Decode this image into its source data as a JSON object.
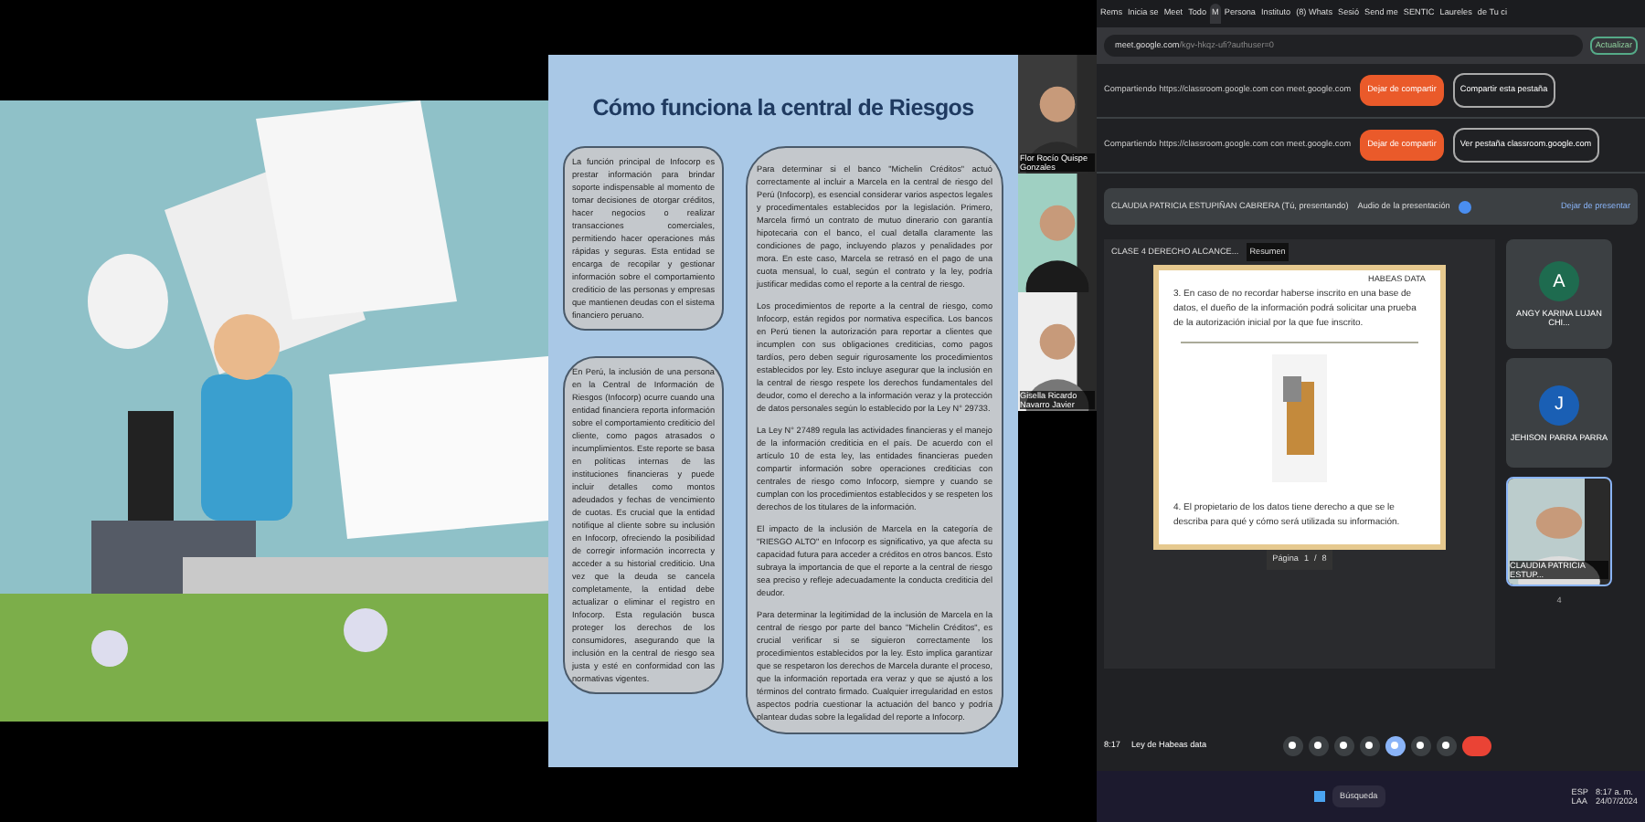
{
  "slide": {
    "title": "Cómo funciona la central de Riesgos",
    "left_boxes": [
      [
        "La función principal de Infocorp es prestar información para brindar soporte indispensable al momento de tomar decisiones de otorgar créditos, hacer negocios o realizar transacciones comerciales, permitiendo hacer operaciones más rápidas y seguras. Esta entidad se encarga de recopilar y gestionar información sobre el comportamiento crediticio de las personas y empresas que mantienen deudas con el sistema financiero peruano."
      ],
      [
        "En Perú, la inclusión de una persona en la Central de Información de Riesgos (Infocorp) ocurre cuando una entidad financiera reporta información sobre el comportamiento crediticio del cliente, como pagos atrasados o incumplimientos. Este reporte se basa en políticas internas de las instituciones financieras y puede incluir detalles como montos adeudados y fechas de vencimiento de cuotas. Es crucial que la entidad notifique al cliente sobre su inclusión en Infocorp, ofreciendo la posibilidad de corregir información incorrecta y acceder a su historial crediticio. Una vez que la deuda se cancela completamente, la entidad debe actualizar o eliminar el registro en Infocorp. Esta regulación busca proteger los derechos de los consumidores, asegurando que la inclusión en la central de riesgo sea justa y esté en conformidad con las normativas vigentes."
      ]
    ],
    "right_box": [
      "Para determinar si el banco \"Michelin Créditos\" actuó correctamente al incluir a Marcela en la central de riesgo del Perú (Infocorp), es esencial considerar varios aspectos legales y procedimentales establecidos por la legislación. Primero, Marcela firmó un contrato de mutuo dinerario con garantía hipotecaria con el banco, el cual detalla claramente las condiciones de pago, incluyendo plazos y penalidades por mora. En este caso, Marcela se retrasó en el pago de una cuota mensual, lo cual, según el contrato y la ley, podría justificar medidas como el reporte a la central de riesgo.",
      "Los procedimientos de reporte a la central de riesgo, como Infocorp, están regidos por normativa específica. Los bancos en Perú tienen la autorización para reportar a clientes que incumplen con sus obligaciones crediticias, como pagos tardíos, pero deben seguir rigurosamente los procedimientos establecidos por ley. Esto incluye asegurar que la inclusión en la central de riesgo respete los derechos fundamentales del deudor, como el derecho a la información veraz y la protección de datos personales según lo establecido por la Ley N° 29733.",
      "La Ley N° 27489 regula las actividades financieras y el manejo de la información crediticia en el país. De acuerdo con el artículo 10 de esta ley, las entidades financieras pueden compartir información sobre operaciones crediticias con centrales de riesgo como Infocorp, siempre y cuando se cumplan con los procedimientos establecidos y se respeten los derechos de los titulares de la información.",
      "El impacto de la inclusión de Marcela en la categoría de \"RIESGO ALTO\" en Infocorp es significativo, ya que afecta su capacidad futura para acceder a créditos en otros bancos. Esto subraya la importancia de que el reporte a la central de riesgo sea preciso y refleje adecuadamente la conducta crediticia del deudor.",
      "Para determinar la legitimidad de la inclusión de Marcela en la central de riesgo por parte del banco \"Michelin Créditos\", es crucial verificar si se siguieron correctamente los procedimientos establecidos por la ley. Esto implica garantizar que se respetaron los derechos de Marcela durante el proceso, que la información reportada era veraz y que se ajustó a los términos del contrato firmado. Cualquier irregularidad en estos aspectos podría cuestionar la actuación del banco y podría plantear dudas sobre la legalidad del reporte a Infocorp."
    ]
  },
  "video_tiles": [
    {
      "kind": "video",
      "name": "Flor Rocío Quispe Gonzales"
    },
    {
      "kind": "video"
    },
    {
      "kind": "video",
      "name": "Gisella Ricardo Navarro Javier"
    }
  ],
  "browser": {
    "tabs": [
      {
        "label": "Rems",
        "selected": false
      },
      {
        "label": "Inicia se",
        "selected": false
      },
      {
        "label": "Meet",
        "selected": false
      },
      {
        "label": "Todo",
        "selected": false
      },
      {
        "label": "M",
        "selected": true
      },
      {
        "label": "Persona",
        "selected": false
      },
      {
        "label": "Instituto",
        "selected": false
      },
      {
        "label": "(8) Whats",
        "selected": false
      },
      {
        "label": "Sesió",
        "selected": false
      },
      {
        "label": "Send me",
        "selected": false
      },
      {
        "label": "SENTIC",
        "selected": false
      },
      {
        "label": "Laureles",
        "selected": false
      },
      {
        "label": "de Tu ci",
        "selected": false
      }
    ],
    "address": "meet.google.com",
    "address_path": "/kgv-hkqz-ufi?authuser=0",
    "update_button": "Actualizar"
  },
  "share_bars": [
    {
      "text": "Compartiendo https://classroom.google.com con meet.google.com",
      "stop": "Dejar de compartir",
      "other": "Compartir esta pestaña"
    },
    {
      "text": "Compartiendo https://classroom.google.com con meet.google.com",
      "stop": "Dejar de compartir",
      "other": "Ver pestaña classroom.google.com"
    }
  ],
  "presenter_bar": {
    "name": "CLAUDIA PATRICIA ESTUPIÑAN CABRERA (Tú, presentando)",
    "audio": "Audio de la presentación",
    "audio_on": true,
    "stop": "Dejar de presentar"
  },
  "document": {
    "file": "CLASE 4 DERECHO ALCANCE...",
    "summary": "Resumen",
    "header": "HABEAS DATA",
    "paragraphs": [
      "3. En caso de no recordar haberse inscrito en una base de datos, el dueño de la información podrá solicitar una prueba de la autorización inicial por la que fue inscrito.",
      "4. El propietario de los datos tiene derecho a que se le describa para qué y cómo será utilizada su información."
    ],
    "page_label": "Página",
    "page": "1",
    "page_sep": "/",
    "page_total": "8"
  },
  "participants": [
    {
      "kind": "avatar",
      "initial": "A",
      "name": "ANGY KARINA LUJAN CHI...",
      "color": "#1e6b4f"
    },
    {
      "kind": "avatar",
      "initial": "J",
      "name": "JEHISON PARRA PARRA",
      "color": "#1a5fb4"
    },
    {
      "kind": "video",
      "name": "CLAUDIA PATRICIA ESTUP..."
    }
  ],
  "meeting": {
    "time": "8:17",
    "title": "Ley de Habeas data",
    "participant_count": "4"
  },
  "taskbar": {
    "search": "Búsqueda",
    "lang": "ESP",
    "layout": "LAA",
    "time": "8:17 a. m.",
    "date": "24/07/2024"
  }
}
